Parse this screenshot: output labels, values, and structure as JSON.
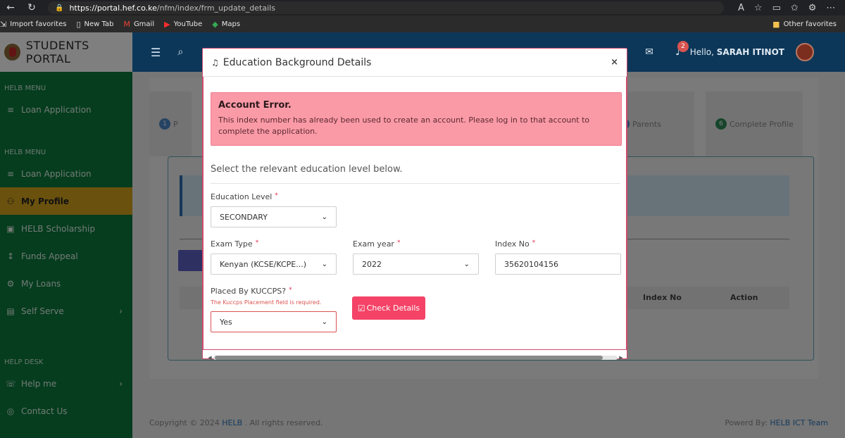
{
  "browser": {
    "url_host": "https://portal.hef.co.ke",
    "url_path": "/nfm/index/frm_update_details",
    "bookmarks": [
      {
        "label": "Import favorites",
        "icon": "import-icon"
      },
      {
        "label": "New Tab",
        "icon": "page-icon"
      },
      {
        "label": "Gmail",
        "icon": "gmail-icon"
      },
      {
        "label": "YouTube",
        "icon": "youtube-icon"
      },
      {
        "label": "Maps",
        "icon": "maps-icon"
      }
    ],
    "other_favorites": "Other favorites"
  },
  "sidebar": {
    "brand": "STUDENTS PORTAL",
    "sections": [
      {
        "label": "HELB MENU",
        "items": [
          {
            "label": "Loan Application",
            "icon": "menu-icon"
          }
        ]
      },
      {
        "label": "HELB MENU",
        "items": [
          {
            "label": "Loan Application",
            "icon": "menu-icon"
          },
          {
            "label": "My Profile",
            "icon": "user-icon",
            "active": true
          },
          {
            "label": "HELB Scholarship",
            "icon": "certificate-icon"
          },
          {
            "label": "Funds Appeal",
            "icon": "arrows-icon"
          },
          {
            "label": "My Loans",
            "icon": "loans-icon"
          },
          {
            "label": "Self Serve",
            "icon": "calendar-icon",
            "chevron": true
          }
        ]
      },
      {
        "label": "HELP DESK",
        "items": [
          {
            "label": "Help me",
            "icon": "help-icon",
            "chevron": true
          },
          {
            "label": "Contact Us",
            "icon": "contact-icon"
          }
        ]
      }
    ]
  },
  "topbar": {
    "greeting": "Hello,",
    "user_name": "SARAH ITINOT",
    "notification_count": "2"
  },
  "steps": [
    {
      "num": "1",
      "label": "P"
    },
    {
      "num": "5",
      "label": "Parents"
    },
    {
      "num": "6",
      "label": "Complete Profile"
    }
  ],
  "table_headers": {
    "index_no": "Index No",
    "action": "Action"
  },
  "footer": {
    "copyright_prefix": "Copyright © 2024",
    "org_link": "HELB",
    "copyright_suffix": ". All rights reserved.",
    "powered_prefix": "Powerd By:",
    "powered_link": "HELB ICT Team"
  },
  "modal": {
    "title": "Education Background Details",
    "close_label": "×",
    "alert": {
      "title": "Account Error.",
      "text": "This index number has already been used to create an account. Please log in to that account to complete the application."
    },
    "lead": "Select the relevant education level below.",
    "fields": {
      "education_level": {
        "label": "Education Level",
        "value": "SECONDARY"
      },
      "exam_type": {
        "label": "Exam Type",
        "value": "Kenyan (KCSE/KCPE...)"
      },
      "exam_year": {
        "label": "Exam year",
        "value": "2022"
      },
      "index_no": {
        "label": "Index No",
        "value": "35620104156"
      },
      "placed_by_kuccps": {
        "label": "Placed By KUCCPS?",
        "value": "Yes",
        "error": "The Kuccps Placement field is required."
      }
    },
    "check_button": "Check Details",
    "required_mark": "*"
  }
}
